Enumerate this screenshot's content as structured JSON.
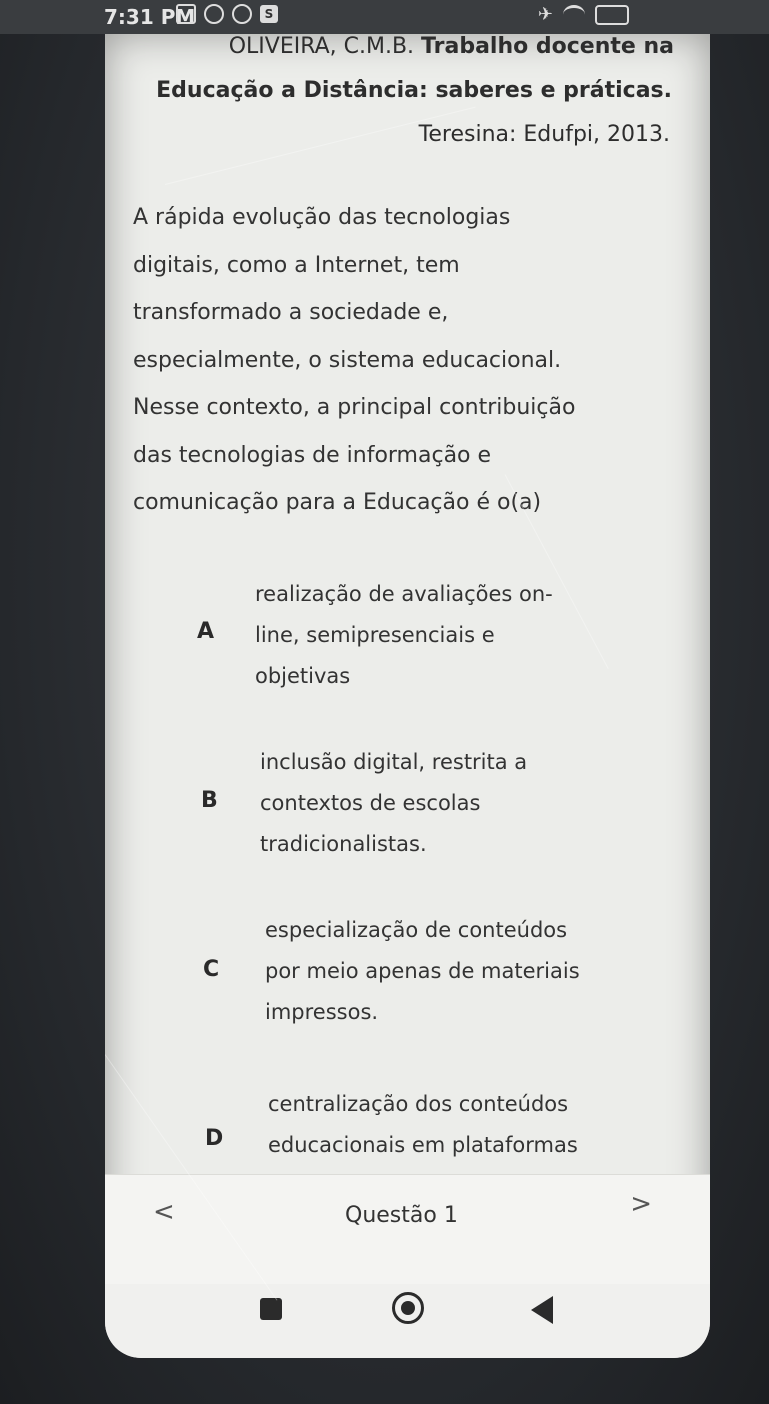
{
  "status_bar": {
    "time": "7:31 PM",
    "badge": "S",
    "icons_left": [
      "alarm-icon",
      "clock-icon",
      "whatsapp-icon"
    ],
    "icons_right": [
      "airplane-icon",
      "wifi-icon",
      "battery-icon"
    ]
  },
  "reference": {
    "line1_normal": "OLIVEIRA, C.M.B. ",
    "line1_bold": "Trabalho docente na",
    "line2": "Educação a Distância: saberes e práticas.",
    "line3": "Teresina: Edufpi, 2013."
  },
  "question": {
    "lines": [
      "A rápida evolução das tecnologias",
      "digitais, como a Internet, tem",
      "transformado a sociedade e,",
      "especialmente, o sistema educacional.",
      "Nesse contexto, a principal contribuição",
      "das tecnologias de informação e",
      "comunicação para a Educação é o(a)"
    ]
  },
  "options": [
    {
      "letter": "A",
      "lines": [
        "realização de avaliações on-",
        "line, semipresenciais e",
        "objetivas"
      ]
    },
    {
      "letter": "B",
      "lines": [
        "inclusão digital, restrita a",
        "contextos de escolas",
        "tradicionalistas."
      ]
    },
    {
      "letter": "C",
      "lines": [
        "especialização de conteúdos",
        "por meio apenas de materiais",
        "impressos."
      ]
    },
    {
      "letter": "D",
      "lines": [
        "centralização dos conteúdos",
        "educacionais em plataformas"
      ]
    }
  ],
  "question_nav": {
    "prev": "<",
    "title": "Questão 1",
    "next": ">"
  }
}
